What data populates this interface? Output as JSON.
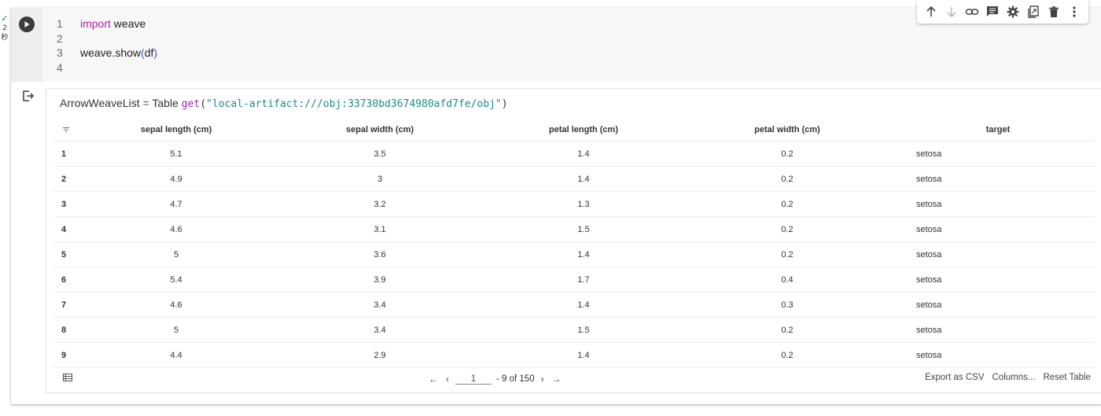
{
  "exec_status": {
    "check": "✓",
    "time_value": "2",
    "time_unit": "秒"
  },
  "code": {
    "lines": [
      {
        "num": "1",
        "keyword": "import",
        "rest": "weave",
        "call": "",
        "arg": ""
      },
      {
        "num": "2",
        "keyword": "",
        "rest": "",
        "call": "",
        "arg": ""
      },
      {
        "num": "3",
        "keyword": "",
        "rest": "",
        "call": "weave.show",
        "arg": "df"
      },
      {
        "num": "4",
        "keyword": "",
        "rest": "",
        "call": "",
        "arg": ""
      }
    ]
  },
  "output": {
    "type_name": "ArrowWeaveList",
    "equals": "=",
    "table_word": "Table",
    "fn": "get",
    "path": "\"local-artifact:///obj:33730bd3674980afd7fe/obj\"",
    "columns": [
      "sepal length (cm)",
      "sepal width (cm)",
      "petal length (cm)",
      "petal width (cm)",
      "target"
    ],
    "rows": [
      [
        "1",
        "5.1",
        "3.5",
        "1.4",
        "0.2",
        "setosa"
      ],
      [
        "2",
        "4.9",
        "3",
        "1.4",
        "0.2",
        "setosa"
      ],
      [
        "3",
        "4.7",
        "3.2",
        "1.3",
        "0.2",
        "setosa"
      ],
      [
        "4",
        "4.6",
        "3.1",
        "1.5",
        "0.2",
        "setosa"
      ],
      [
        "5",
        "5",
        "3.6",
        "1.4",
        "0.2",
        "setosa"
      ],
      [
        "6",
        "5.4",
        "3.9",
        "1.7",
        "0.4",
        "setosa"
      ],
      [
        "7",
        "4.6",
        "3.4",
        "1.4",
        "0.3",
        "setosa"
      ],
      [
        "8",
        "5",
        "3.4",
        "1.5",
        "0.2",
        "setosa"
      ],
      [
        "9",
        "4.4",
        "2.9",
        "1.4",
        "0.2",
        "setosa"
      ]
    ],
    "pagination": {
      "first": "←",
      "prev": "‹",
      "page": "1",
      "range": "- 9 of 150",
      "next": "›",
      "last": "→"
    },
    "actions": [
      "Export as CSV",
      "Columns...",
      "Reset Table"
    ]
  },
  "toolbar_icons": [
    "arrow-up-icon",
    "arrow-down-icon",
    "link-icon",
    "comment-icon",
    "settings-icon",
    "mirror-cell-icon",
    "delete-icon",
    "more-vert-icon"
  ],
  "colors": {
    "keyword": "#a626a4",
    "string": "#1c8a8a",
    "paren": "#2f5cd1",
    "check": "#188038"
  }
}
